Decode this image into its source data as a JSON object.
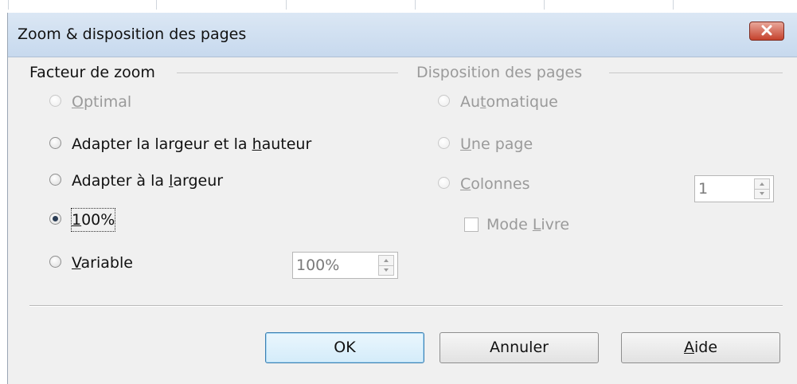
{
  "dialog": {
    "title": "Zoom & disposition des pages"
  },
  "zoom_factor": {
    "title": "Facteur de zoom",
    "options": [
      {
        "pre": "",
        "mnemonic": "O",
        "post": "ptimal",
        "enabled": false,
        "selected": false
      },
      {
        "pre": "Adapter la largeur et la ",
        "mnemonic": "h",
        "post": "auteur",
        "enabled": true,
        "selected": false
      },
      {
        "pre": "Adapter à la ",
        "mnemonic": "l",
        "post": "argeur",
        "enabled": true,
        "selected": false
      },
      {
        "pre": "",
        "mnemonic": "1",
        "post": "00%",
        "enabled": true,
        "selected": true
      },
      {
        "pre": "",
        "mnemonic": "V",
        "post": "ariable",
        "enabled": true,
        "selected": false
      }
    ],
    "variable_value": "100%"
  },
  "page_layout": {
    "title": "Disposition des pages",
    "options": [
      {
        "pre": "Au",
        "mnemonic": "t",
        "post": "omatique",
        "enabled": false,
        "selected": false
      },
      {
        "pre": "",
        "mnemonic": "U",
        "post": "ne page",
        "enabled": false,
        "selected": false
      },
      {
        "pre": "",
        "mnemonic": "C",
        "post": "olonnes",
        "enabled": false,
        "selected": false
      }
    ],
    "columns_value": "1",
    "book_mode": {
      "pre": "Mode ",
      "mnemonic": "L",
      "post": "ivre",
      "checked": false,
      "enabled": false
    }
  },
  "buttons": {
    "ok": {
      "label": "OK"
    },
    "cancel": {
      "label": "Annuler"
    },
    "help": {
      "pre": "",
      "mnemonic": "A",
      "post": "ide"
    }
  },
  "icons": {
    "close": "close-icon",
    "spin_up": "chevron-up-icon",
    "spin_down": "chevron-down-icon"
  },
  "colors": {
    "selected_radio": "#2b3d55",
    "default_button_border": "#3c7fb1",
    "close_button": "#c5422d"
  }
}
